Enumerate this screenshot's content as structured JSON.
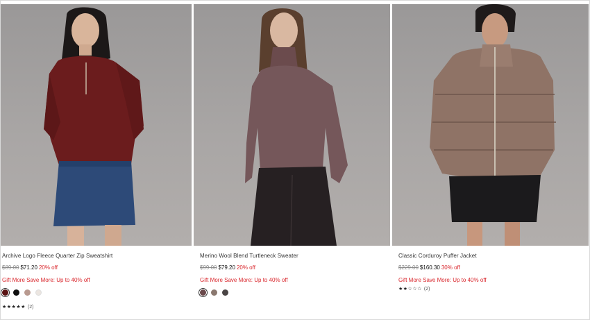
{
  "products": [
    {
      "title": "Archive Logo Fleece Quarter Zip Sweatshirt",
      "original_price": "$89.00",
      "sale_price": "$71.20",
      "discount": "20% off",
      "promo": "Gift More Save More: Up to 40% off",
      "swatches": [
        "#5a1414",
        "#111111",
        "#b99a90",
        "#ece6e1"
      ],
      "selected_swatch": 0,
      "rating": 5,
      "stars_text": "★★★★★",
      "reviews": "(2)"
    },
    {
      "title": "Merino Wool Blend Turtleneck Sweater",
      "original_price": "$99.00",
      "sale_price": "$79.20",
      "discount": "20% off",
      "promo": "Gift More Save More: Up to 40% off",
      "swatches": [
        "#6b4a4c",
        "#8a786f",
        "#4a4545"
      ],
      "selected_swatch": 0,
      "rating": null,
      "stars_text": "",
      "reviews": ""
    },
    {
      "title": "Classic Corduroy Puffer Jacket",
      "original_price": "$229.00",
      "sale_price": "$160.30",
      "discount": "30% off",
      "promo": "Gift More Save More: Up to 40% off",
      "swatches": [],
      "selected_swatch": null,
      "rating": 2,
      "stars_text": "★★☆☆☆",
      "reviews": "(2)"
    }
  ],
  "colors": {
    "sale_red": "#d9262c",
    "strike_gray": "#8a8a8a"
  }
}
